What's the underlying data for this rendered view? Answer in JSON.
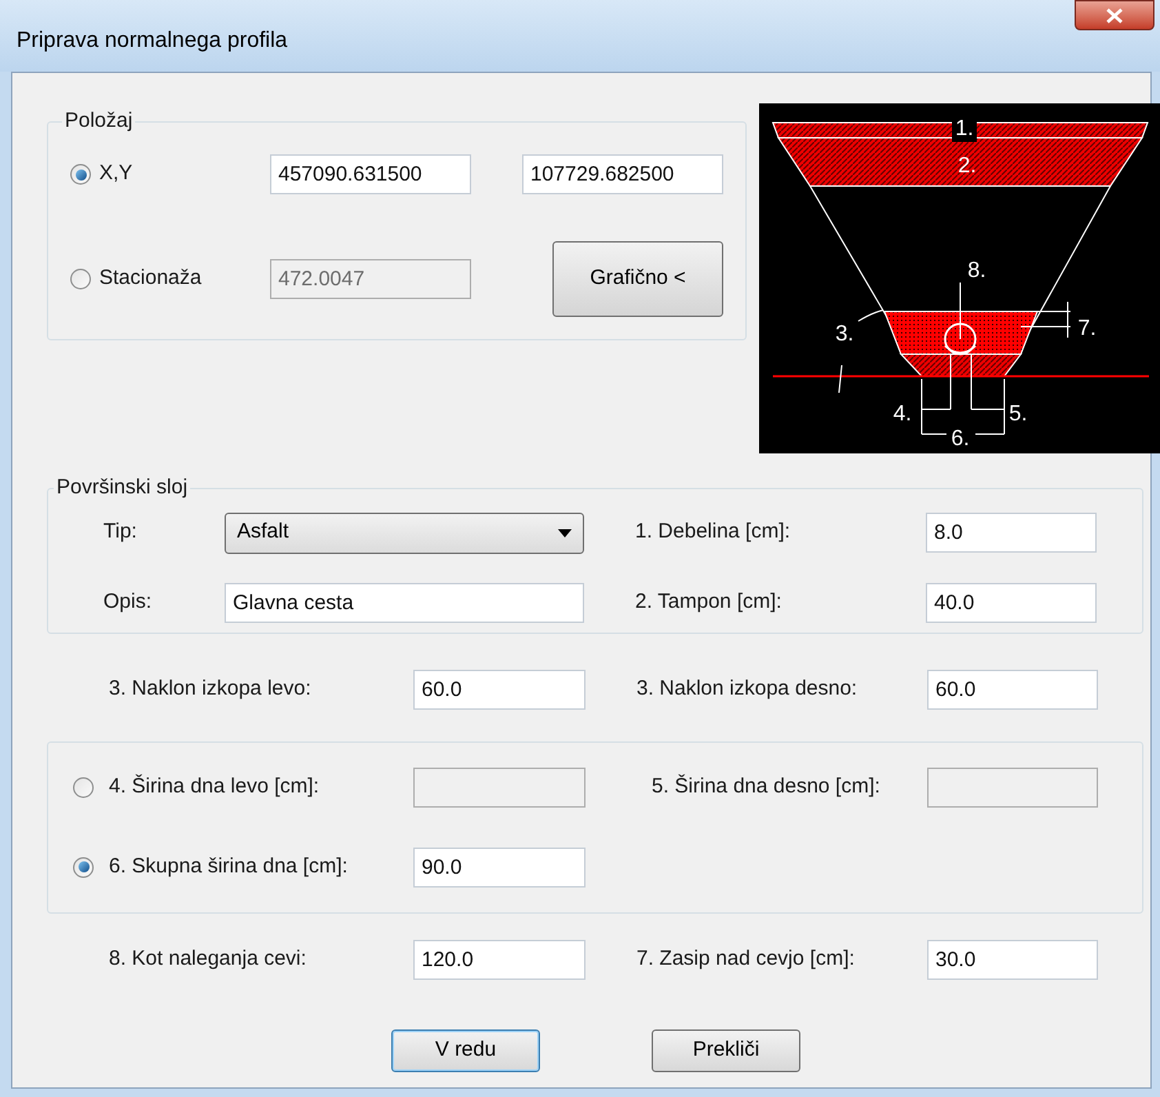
{
  "window": {
    "title": "Priprava normalnega profila"
  },
  "position": {
    "legend": "Položaj",
    "options": [
      {
        "label": "X,Y",
        "selected": true,
        "fields": [
          {
            "value": "457090.631500",
            "disabled": false
          },
          {
            "value": "107729.682500",
            "disabled": false
          }
        ]
      },
      {
        "label": "Stacionaža",
        "selected": false,
        "fields": [
          {
            "value": "472.0047",
            "disabled": true
          }
        ]
      }
    ],
    "graphic_button": "Grafično <"
  },
  "diagram": {
    "labels": [
      "1.",
      "2.",
      "3.",
      "4.",
      "5.",
      "6.",
      "7.",
      "8."
    ]
  },
  "surface_layer": {
    "legend": "Površinski sloj",
    "type": {
      "label": "Tip:",
      "value": "Asfalt"
    },
    "description": {
      "label": "Opis:",
      "value": "Glavna cesta"
    },
    "thickness": {
      "label": "1. Debelina [cm]:",
      "value": "8.0"
    },
    "base": {
      "label": "2. Tampon [cm]:",
      "value": "40.0"
    }
  },
  "slopes": [
    {
      "label": "3. Naklon izkopa levo:",
      "value": "60.0"
    },
    {
      "label": "3. Naklon izkopa desno:",
      "value": "60.0"
    }
  ],
  "width_mode": [
    {
      "label": "4. Širina dna levo [cm]:",
      "selected": false,
      "disabled": true,
      "right": {
        "label": "5. Širina dna desno [cm]:",
        "disabled": true
      }
    },
    {
      "label": "6. Skupna širina dna [cm]:",
      "selected": true,
      "value": "90.0"
    }
  ],
  "pipe": [
    {
      "label": "8. Kot naleganja cevi:",
      "value": "120.0"
    },
    {
      "label": "7. Zasip nad cevjo [cm]:",
      "value": "30.0"
    }
  ],
  "buttons": [
    {
      "label": "V redu",
      "default": true
    },
    {
      "label": "Prekliči",
      "default": false
    }
  ]
}
